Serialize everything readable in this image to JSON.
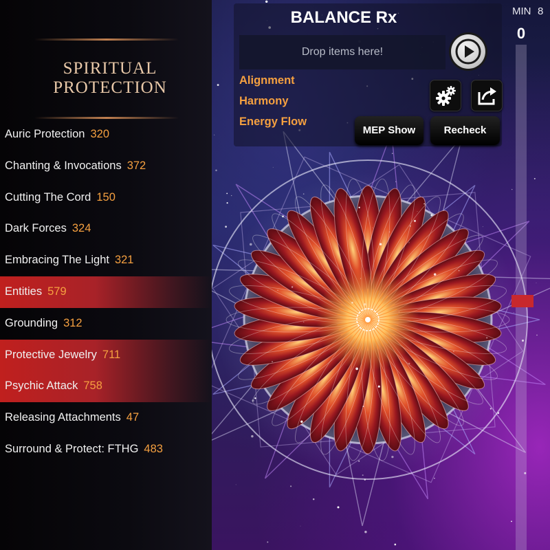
{
  "sidebar": {
    "title_line1": "Spiritual",
    "title_line2": "Protection",
    "items": [
      {
        "label": "Auric Protection",
        "count": "320",
        "highlighted": false
      },
      {
        "label": "Chanting & Invocations",
        "count": "372",
        "highlighted": false
      },
      {
        "label": "Cutting The Cord",
        "count": "150",
        "highlighted": false
      },
      {
        "label": "Dark Forces",
        "count": "324",
        "highlighted": false
      },
      {
        "label": "Embracing The Light",
        "count": "321",
        "highlighted": false
      },
      {
        "label": "Entities",
        "count": "579",
        "highlighted": true
      },
      {
        "label": "Grounding",
        "count": "312",
        "highlighted": false
      },
      {
        "label": "Protective Jewelry",
        "count": "711",
        "highlighted": true
      },
      {
        "label": "Psychic Attack",
        "count": "758",
        "highlighted": true
      },
      {
        "label": "Releasing Attachments",
        "count": "47",
        "highlighted": false
      },
      {
        "label": "Surround & Protect: FTHG",
        "count": "483",
        "highlighted": false
      }
    ]
  },
  "header": {
    "title": "BALANCE Rx",
    "drop_placeholder": "Drop items here!",
    "options": [
      "Alignment",
      "Harmony",
      "Energy Flow"
    ],
    "mep_show_label": "MEP Show",
    "recheck_label": "Recheck",
    "play_icon": "play-icon",
    "settings_icon": "gears-icon",
    "share_icon": "share-icon"
  },
  "slider": {
    "min_label": "MIN",
    "min_value": "8",
    "value": "0",
    "thumb_color": "#c8282d"
  },
  "colors": {
    "accent": "#f5a040",
    "highlight": "#c0201e",
    "title": "#e8c8a8"
  }
}
